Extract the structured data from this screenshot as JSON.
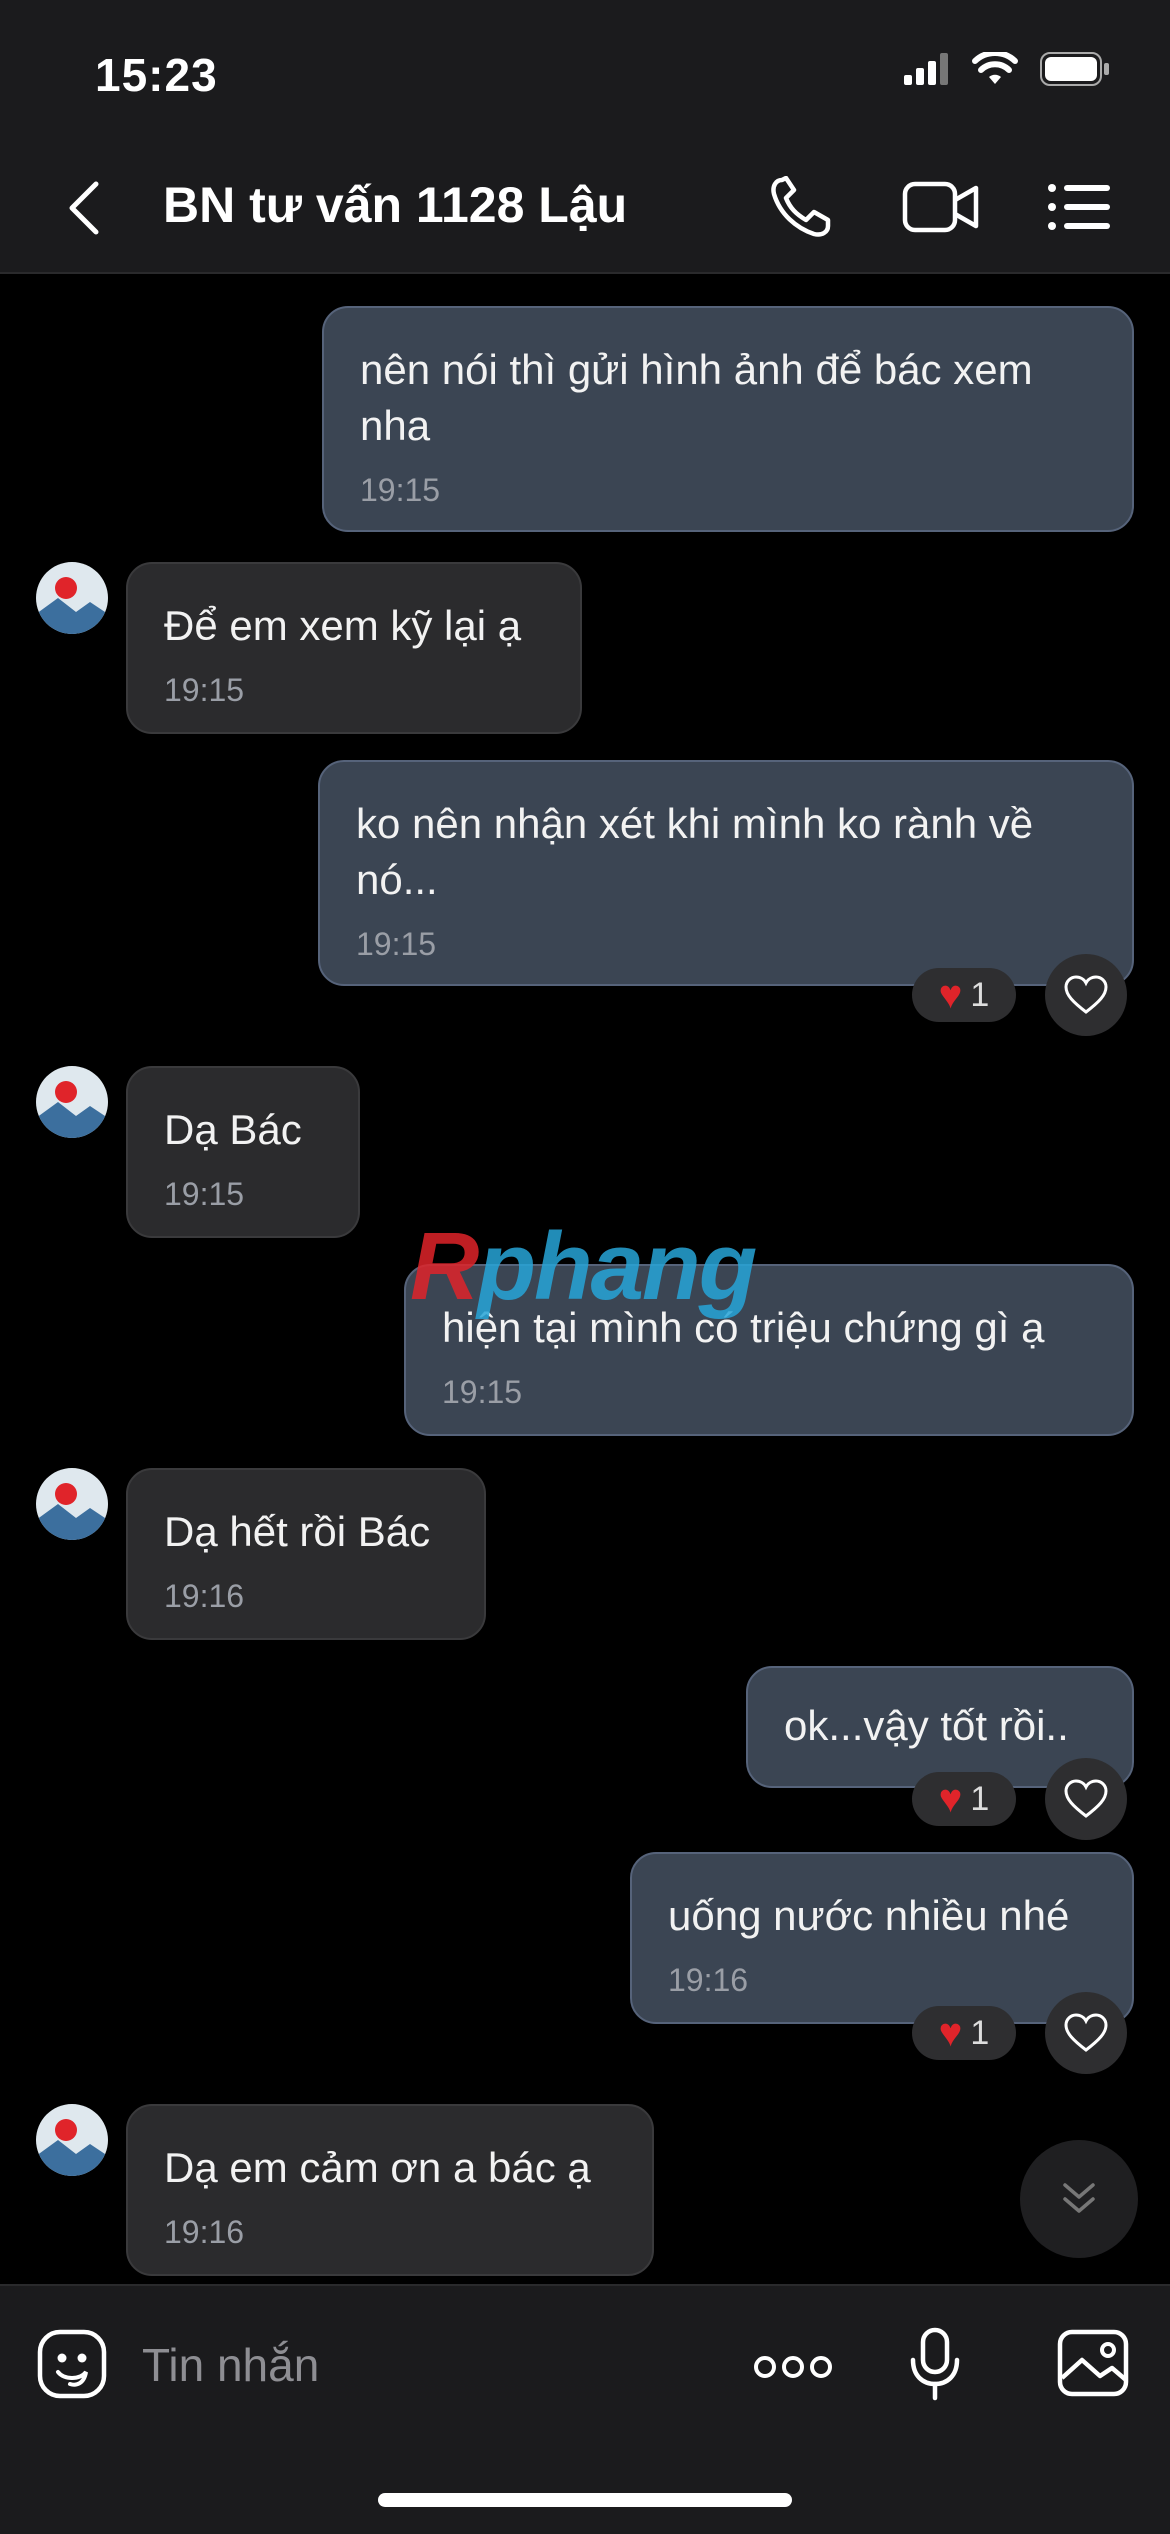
{
  "status_bar": {
    "time": "15:23"
  },
  "header": {
    "title": "BN tư vấn 1128 Lậu"
  },
  "watermark": {
    "prefix": "R",
    "text": "phang"
  },
  "messages": [
    {
      "dir": "out",
      "text": "nên nói thì gửi hình ảnh để bác xem nha",
      "time": "19:15"
    },
    {
      "dir": "in",
      "text": "Để em xem kỹ lại ạ",
      "time": "19:15"
    },
    {
      "dir": "out",
      "text": "ko nên nhận xét khi mình ko rành về nó...",
      "time": "19:15",
      "reaction_count": "1"
    },
    {
      "dir": "in",
      "text": "Dạ Bác",
      "time": "19:15"
    },
    {
      "dir": "out",
      "text": "hiện tại mình có triệu chứng gì ạ",
      "time": "19:15"
    },
    {
      "dir": "in",
      "text": "Dạ hết rồi Bác",
      "time": "19:16"
    },
    {
      "dir": "out",
      "text": "ok...vậy tốt rồi..",
      "time": "",
      "reaction_count": "1"
    },
    {
      "dir": "out",
      "text": "uống nước nhiều nhé",
      "time": "19:16",
      "reaction_count": "1"
    },
    {
      "dir": "in",
      "text": "Dạ em cảm ơn a bác ạ",
      "time": "19:16"
    }
  ],
  "input": {
    "placeholder": "Tin nhắn"
  },
  "colors": {
    "outgoing_bubble": "#3b4553",
    "incoming_bubble": "#2b2b2d",
    "reaction_heart": "#e0242a"
  }
}
